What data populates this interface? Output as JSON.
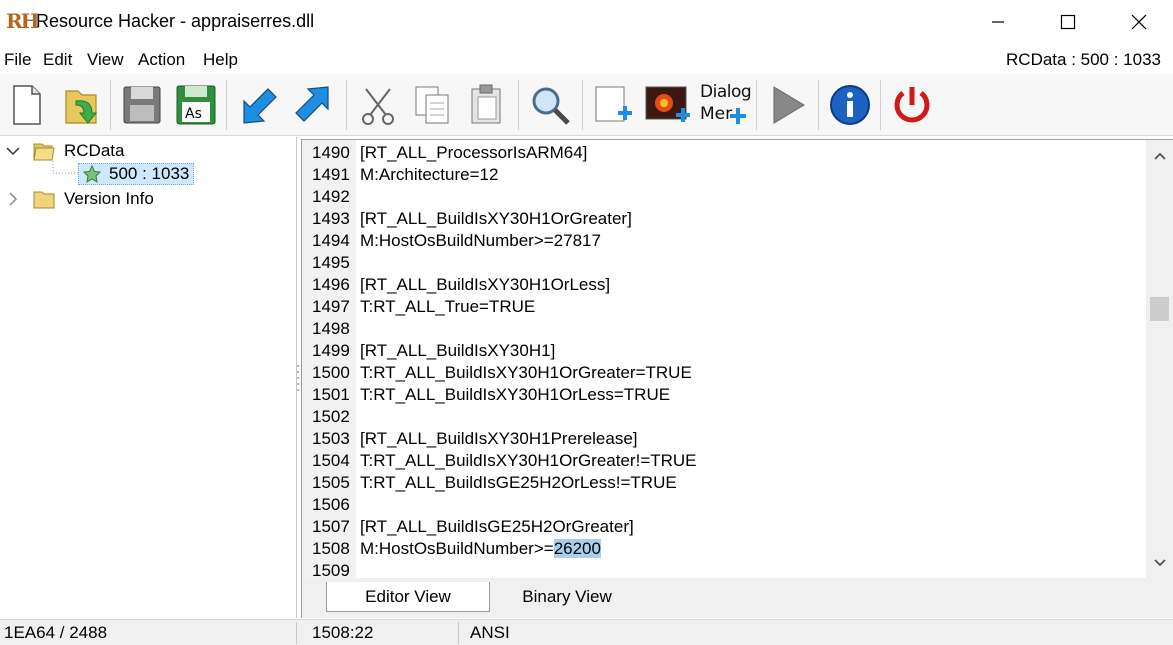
{
  "window": {
    "title": "Resource Hacker - appraiserres.dll",
    "logo_text": "RH"
  },
  "menu": {
    "items": [
      "File",
      "Edit",
      "View",
      "Action",
      "Help"
    ],
    "resource_status": "RCData : 500 : 1033"
  },
  "toolbar": {
    "dialog_menu_label_line1": "Dialog",
    "dialog_menu_label_line2": "Mer",
    "buttons": [
      "new-icon",
      "open-icon",
      "save-icon",
      "save-as-icon",
      "compile-icon",
      "add-from-file-icon",
      "cut-icon",
      "copy-icon",
      "paste-icon",
      "find-icon",
      "add-blank-resource-icon",
      "add-image-resource-icon",
      "dialog-menu-editor-icon",
      "run-script-icon",
      "about-icon",
      "exit-icon"
    ],
    "save_as_label": "As",
    "colors": {
      "accent_blue": "#1e8fe0",
      "exit_red": "#d01a1a",
      "folder_yellow": "#e8c85c",
      "green_save": "#2f8f3f"
    }
  },
  "tree": {
    "nodes": [
      {
        "label": "RCData",
        "expanded": true
      },
      {
        "label": "500 : 1033",
        "selected": true
      },
      {
        "label": "Version Info",
        "expanded": false
      }
    ]
  },
  "editor": {
    "lines": [
      {
        "num": "1490",
        "text": "[RT_ALL_ProcessorIsARM64]"
      },
      {
        "num": "1491",
        "text": "M:Architecture=12"
      },
      {
        "num": "1492",
        "text": ""
      },
      {
        "num": "1493",
        "text": "[RT_ALL_BuildIsXY30H1OrGreater]"
      },
      {
        "num": "1494",
        "text": "M:HostOsBuildNumber>=27817"
      },
      {
        "num": "1495",
        "text": ""
      },
      {
        "num": "1496",
        "text": "[RT_ALL_BuildIsXY30H1OrLess]"
      },
      {
        "num": "1497",
        "text": "T:RT_ALL_True=TRUE"
      },
      {
        "num": "1498",
        "text": ""
      },
      {
        "num": "1499",
        "text": "[RT_ALL_BuildIsXY30H1]"
      },
      {
        "num": "1500",
        "text": "T:RT_ALL_BuildIsXY30H1OrGreater=TRUE"
      },
      {
        "num": "1501",
        "text": "T:RT_ALL_BuildIsXY30H1OrLess=TRUE"
      },
      {
        "num": "1502",
        "text": ""
      },
      {
        "num": "1503",
        "text": "[RT_ALL_BuildIsXY30H1Prerelease]"
      },
      {
        "num": "1504",
        "text": "T:RT_ALL_BuildIsXY30H1OrGreater!=TRUE"
      },
      {
        "num": "1505",
        "text": "T:RT_ALL_BuildIsGE25H2OrLess!=TRUE"
      },
      {
        "num": "1506",
        "text": ""
      },
      {
        "num": "1507",
        "text": "[RT_ALL_BuildIsGE25H2OrGreater]"
      },
      {
        "num": "1508",
        "text": "M:HostOsBuildNumber>=",
        "highlight": "26200"
      },
      {
        "num": "1509",
        "text": ""
      }
    ],
    "scroll_position_fraction": 0.36,
    "highlight_color": "#a8cfee"
  },
  "tabs": {
    "editor_view": "Editor View",
    "binary_view": "Binary View",
    "active": "Editor View"
  },
  "status": {
    "offset": "1EA64 / 2488",
    "cursor": "1508:22",
    "encoding": "ANSI"
  }
}
